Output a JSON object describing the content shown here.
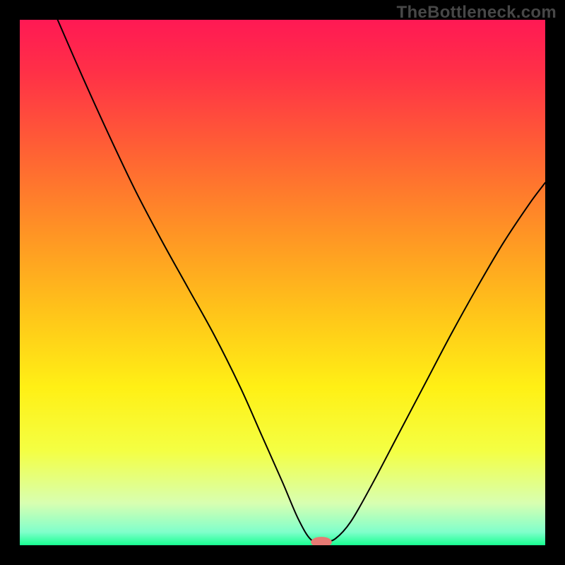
{
  "watermark": "TheBottleneck.com",
  "gradient": {
    "stops": [
      {
        "offset": 0.0,
        "color": "#ff1954"
      },
      {
        "offset": 0.1,
        "color": "#ff3047"
      },
      {
        "offset": 0.25,
        "color": "#ff6134"
      },
      {
        "offset": 0.4,
        "color": "#ff9225"
      },
      {
        "offset": 0.55,
        "color": "#ffc21a"
      },
      {
        "offset": 0.7,
        "color": "#fff015"
      },
      {
        "offset": 0.82,
        "color": "#f4ff43"
      },
      {
        "offset": 0.92,
        "color": "#d8ffb1"
      },
      {
        "offset": 0.975,
        "color": "#80ffcb"
      },
      {
        "offset": 1.0,
        "color": "#18ff91"
      }
    ]
  },
  "chart_data": {
    "type": "line",
    "title": "",
    "xlabel": "",
    "ylabel": "",
    "xlim": [
      0,
      1
    ],
    "ylim": [
      0,
      1
    ],
    "note": "Axis values are not labeled in the original image; x and y are normalized plotting coordinates with y=0 at the top of the plot area.",
    "marker": {
      "x": 0.574,
      "y": 0.994,
      "rx": 0.02,
      "ry": 0.01
    },
    "series": [
      {
        "name": "bottleneck-curve",
        "points": [
          {
            "x": 0.072,
            "y": 0.0
          },
          {
            "x": 0.12,
            "y": 0.11
          },
          {
            "x": 0.17,
            "y": 0.22
          },
          {
            "x": 0.22,
            "y": 0.325
          },
          {
            "x": 0.27,
            "y": 0.42
          },
          {
            "x": 0.32,
            "y": 0.51
          },
          {
            "x": 0.37,
            "y": 0.6
          },
          {
            "x": 0.42,
            "y": 0.7
          },
          {
            "x": 0.46,
            "y": 0.79
          },
          {
            "x": 0.5,
            "y": 0.88
          },
          {
            "x": 0.53,
            "y": 0.95
          },
          {
            "x": 0.555,
            "y": 0.99
          },
          {
            "x": 0.58,
            "y": 0.992
          },
          {
            "x": 0.6,
            "y": 0.988
          },
          {
            "x": 0.63,
            "y": 0.955
          },
          {
            "x": 0.67,
            "y": 0.885
          },
          {
            "x": 0.72,
            "y": 0.79
          },
          {
            "x": 0.77,
            "y": 0.695
          },
          {
            "x": 0.82,
            "y": 0.6
          },
          {
            "x": 0.87,
            "y": 0.51
          },
          {
            "x": 0.92,
            "y": 0.425
          },
          {
            "x": 0.97,
            "y": 0.35
          },
          {
            "x": 1.0,
            "y": 0.31
          }
        ]
      }
    ]
  }
}
